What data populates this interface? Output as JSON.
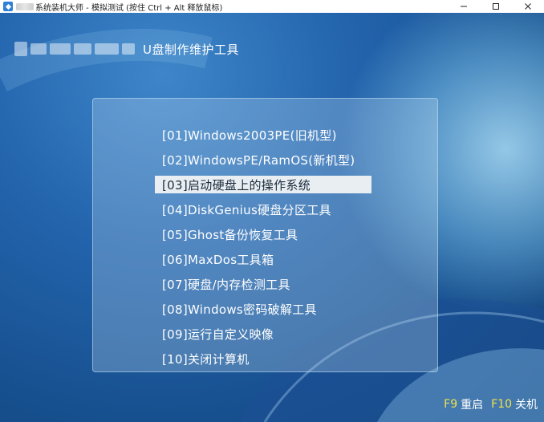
{
  "window": {
    "title": "系统装机大师 - 模拟测试 (按住 Ctrl + Alt 释放鼠标)",
    "controls": {
      "minimize": "—",
      "maximize": "☐",
      "close": "✕"
    }
  },
  "header": {
    "title": "U盘制作维护工具"
  },
  "menu": {
    "items": [
      {
        "label": "[01]Windows2003PE(旧机型)",
        "selected": false
      },
      {
        "label": "[02]WindowsPE/RamOS(新机型)",
        "selected": false
      },
      {
        "label": "[03]启动硬盘上的操作系统",
        "selected": true
      },
      {
        "label": "[04]DiskGenius硬盘分区工具",
        "selected": false
      },
      {
        "label": "[05]Ghost备份恢复工具",
        "selected": false
      },
      {
        "label": "[06]MaxDos工具箱",
        "selected": false
      },
      {
        "label": "[07]硬盘/内存检测工具",
        "selected": false
      },
      {
        "label": "[08]Windows密码破解工具",
        "selected": false
      },
      {
        "label": "[09]运行自定义映像",
        "selected": false
      },
      {
        "label": "[10]关闭计算机",
        "selected": false
      }
    ]
  },
  "footer": {
    "f9_key": "F9",
    "f9_label": "重启",
    "f10_key": "F10",
    "f10_label": "关机"
  },
  "colors": {
    "background": "#2364ad",
    "selected_bg": "#e9eef3",
    "key_hint": "#f2e24a"
  },
  "icons": {
    "app": "app-icon",
    "minimize": "minimize-icon",
    "maximize": "maximize-icon",
    "close": "close-icon"
  }
}
